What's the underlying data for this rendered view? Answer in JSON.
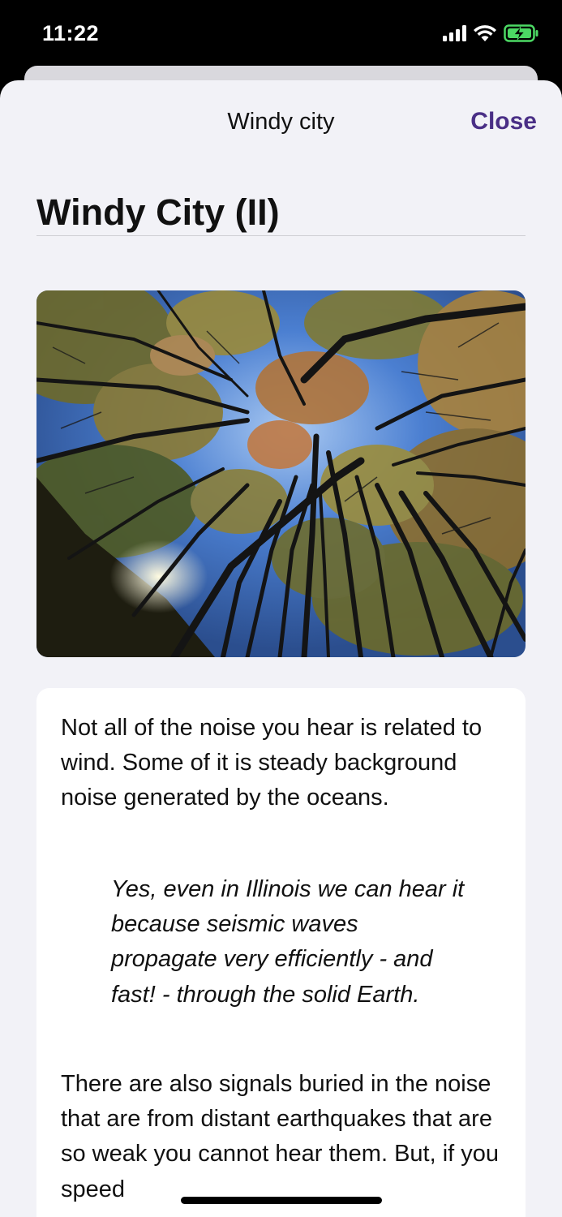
{
  "status_bar": {
    "time": "11:22"
  },
  "header": {
    "title": "Windy city",
    "close_label": "Close"
  },
  "article": {
    "title": "Windy City (II)",
    "image_icon": "forest-canopy-photo",
    "paragraph_1": "Not all of the noise you hear is related to wind. Some of it is steady background noise generated by the oceans.",
    "quote": "Yes, even in Illinois we can hear it because seismic waves propagate very efficiently - and fast! -  through the solid Earth.",
    "paragraph_2": "There are also signals buried in the noise that are from distant earthquakes that are so weak you cannot hear them. But, if you speed"
  },
  "colors": {
    "accent": "#4a2f86",
    "background": "#f2f2f7",
    "card": "#ffffff"
  }
}
